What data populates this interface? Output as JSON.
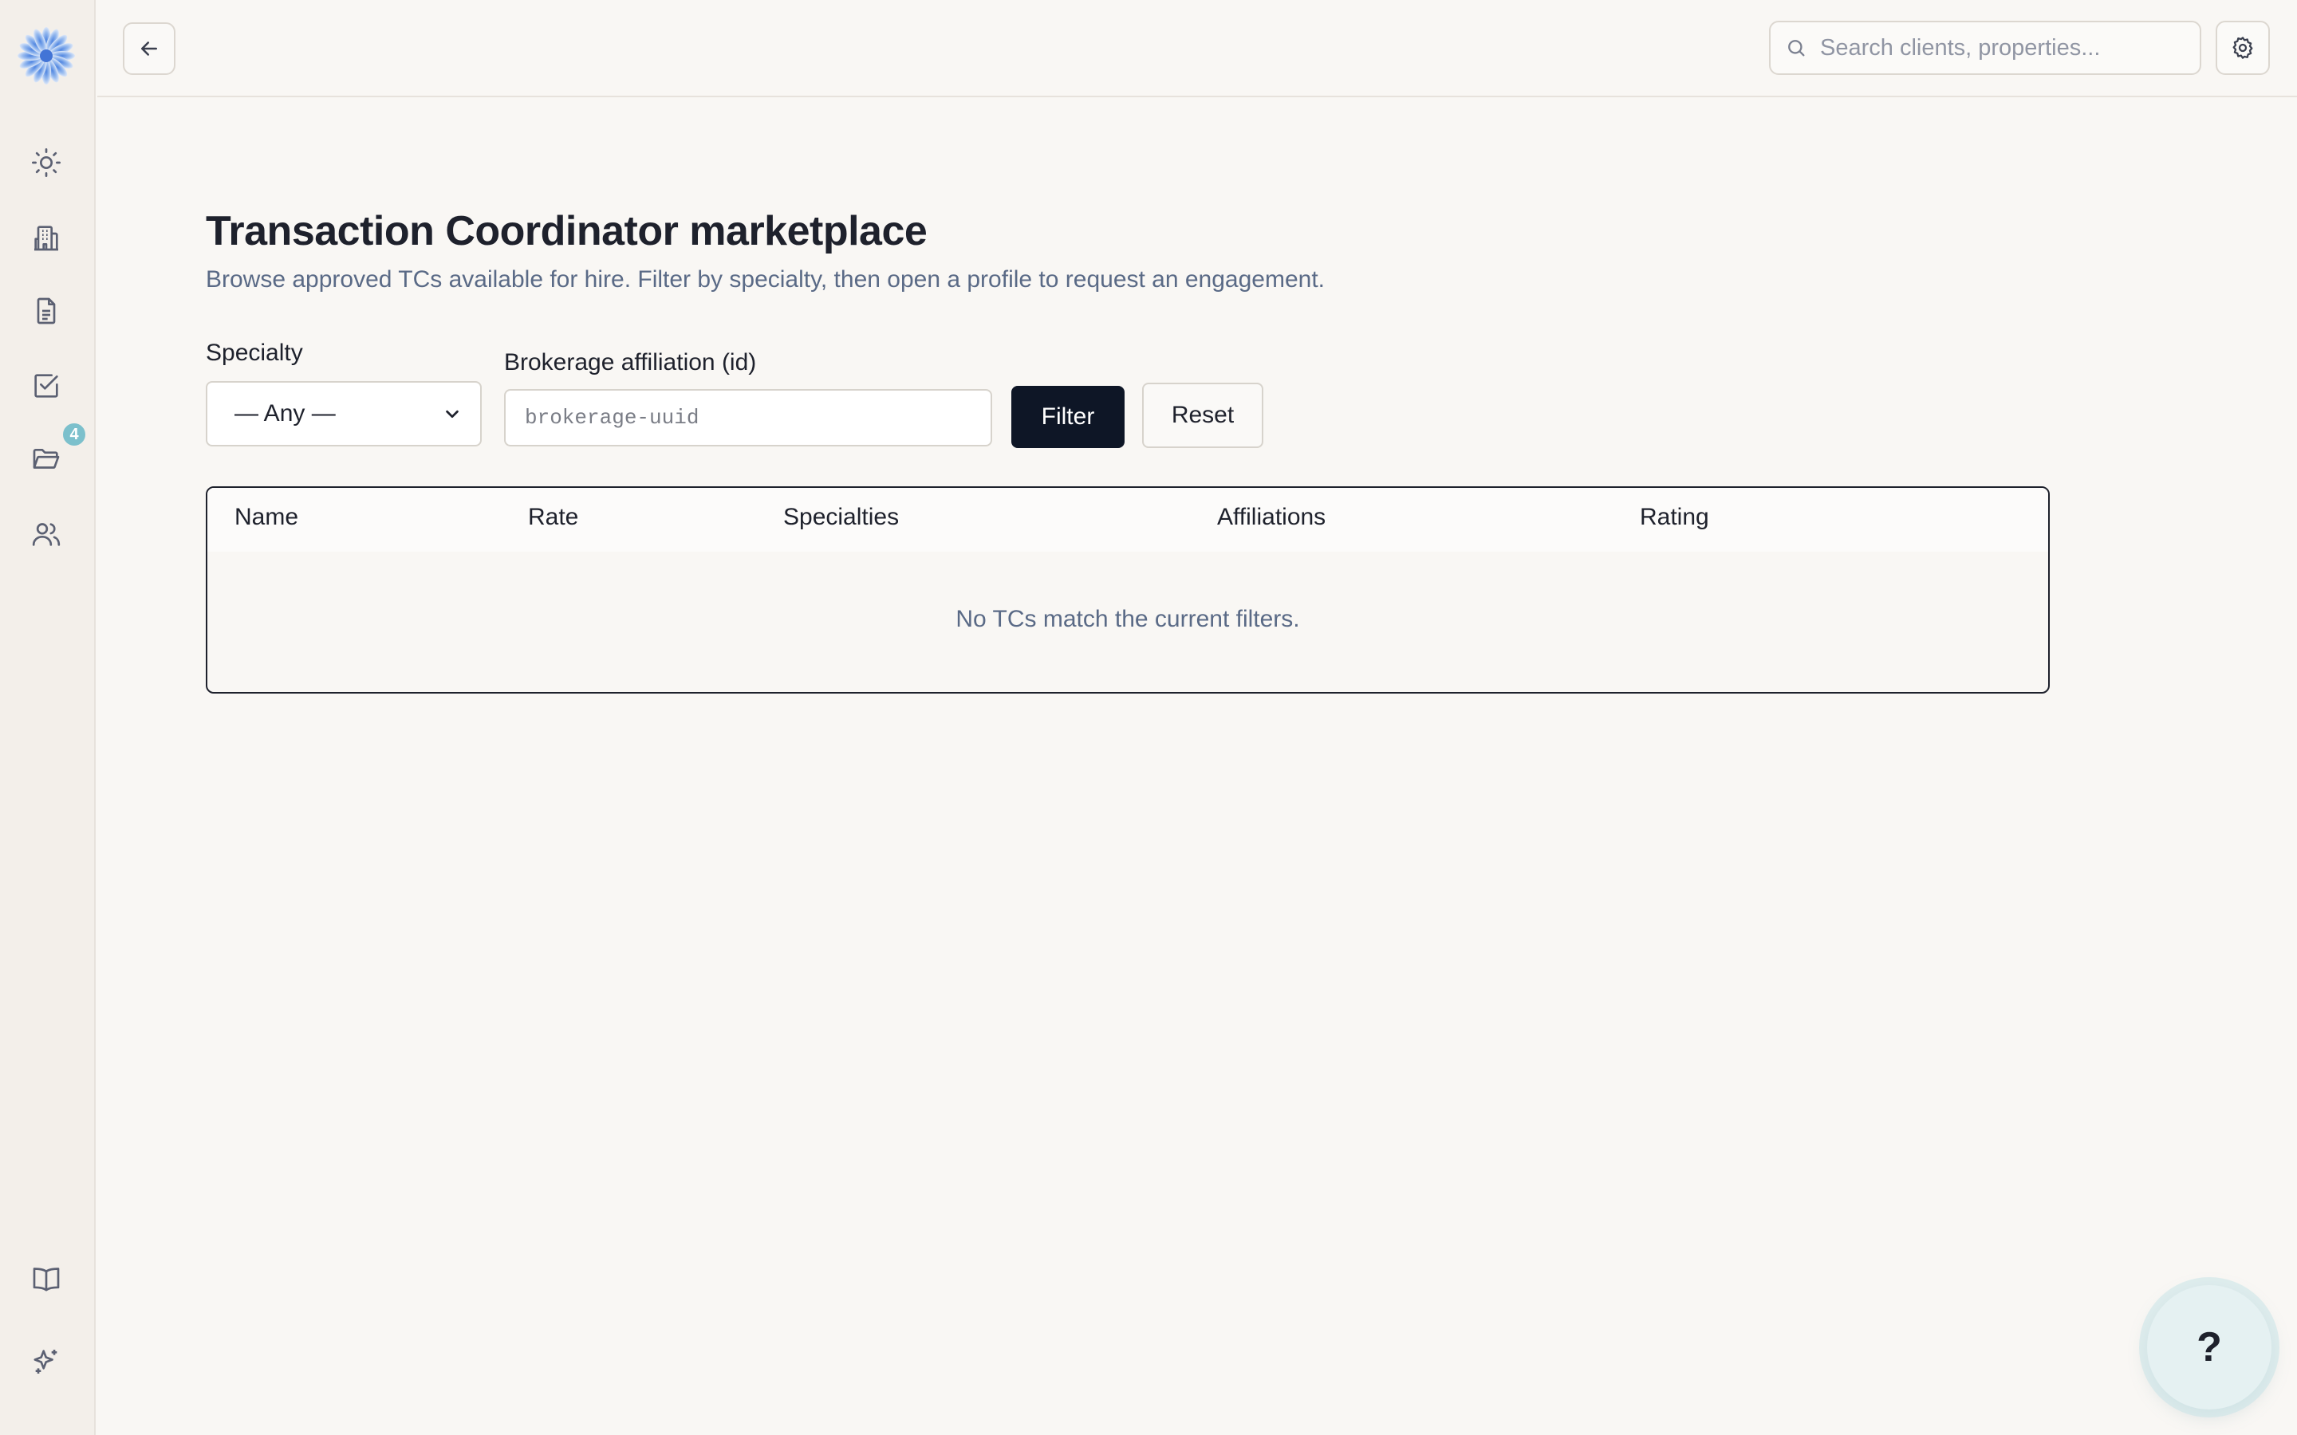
{
  "sidebar": {
    "nav": [
      {
        "icon": "sun-icon"
      },
      {
        "icon": "building-icon"
      },
      {
        "icon": "document-icon"
      },
      {
        "icon": "checkbox-icon"
      },
      {
        "icon": "folder-icon",
        "badge": "4"
      },
      {
        "icon": "users-icon"
      }
    ],
    "bottom": [
      {
        "icon": "book-icon"
      },
      {
        "icon": "sparkles-icon"
      }
    ]
  },
  "topbar": {
    "search_placeholder": "Search clients, properties..."
  },
  "page": {
    "title": "Transaction Coordinator marketplace",
    "subtitle": "Browse approved TCs available for hire. Filter by specialty, then open a profile to request an engagement."
  },
  "filters": {
    "specialty_label": "Specialty",
    "specialty_value": "— Any —",
    "brokerage_label": "Brokerage affiliation (id)",
    "brokerage_placeholder": "brokerage-uuid",
    "filter_button": "Filter",
    "reset_button": "Reset"
  },
  "table": {
    "columns": [
      "Name",
      "Rate",
      "Specialties",
      "Affiliations",
      "Rating"
    ],
    "rows": [],
    "empty_message": "No TCs match the current filters."
  },
  "help": {
    "label": "?"
  },
  "colors": {
    "primary_button": "#0e1626",
    "badge": "#7cc0cc",
    "background": "#f9f7f4"
  }
}
